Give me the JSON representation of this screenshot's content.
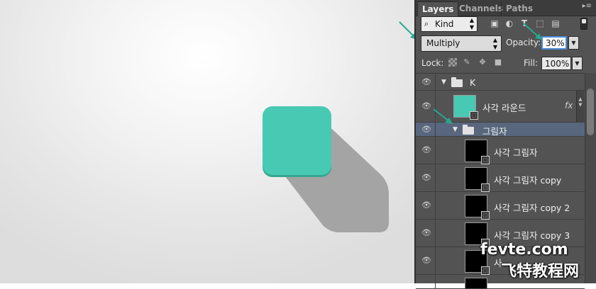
{
  "colors": {
    "accent_teal": "#48c9b3",
    "selected_row": "#59677e",
    "panel_bg": "#535353",
    "shadow_gray": "#a4a4a4",
    "arrow": "#27a88e"
  },
  "panel": {
    "tabs": [
      {
        "label": "Layers"
      },
      {
        "label": "Channels"
      },
      {
        "label": "Paths"
      }
    ],
    "menu_icon": "panel-menu-icon",
    "filter": {
      "kind_label": "Kind",
      "icons": [
        "image-filter-icon",
        "adjustment-filter-icon",
        "type-filter-icon",
        "shape-filter-icon",
        "smart-object-filter-icon"
      ]
    },
    "blend_mode": "Multiply",
    "opacity_label": "Opacity:",
    "opacity_value": "30%",
    "lock_label": "Lock:",
    "fill_label": "Fill:",
    "fill_value": "100%"
  },
  "layers": [
    {
      "name": "K",
      "type": "group",
      "depth": 0
    },
    {
      "name": "사각 라운드",
      "type": "shape",
      "depth": 0,
      "fx": "fx"
    },
    {
      "name": "그림자",
      "type": "group",
      "depth": 1,
      "selected": true
    },
    {
      "name": "사각 그림자",
      "type": "shape",
      "depth": 2
    },
    {
      "name": "사각 그림자 copy",
      "type": "shape",
      "depth": 2
    },
    {
      "name": "사각 그림자 copy 2",
      "type": "shape",
      "depth": 2
    },
    {
      "name": "사각 그림자 copy 3",
      "type": "shape",
      "depth": 2
    },
    {
      "name": "사",
      "type": "shape",
      "depth": 2
    }
  ],
  "watermark": {
    "line1": "fevte.com",
    "line2": "飞特教程网"
  }
}
